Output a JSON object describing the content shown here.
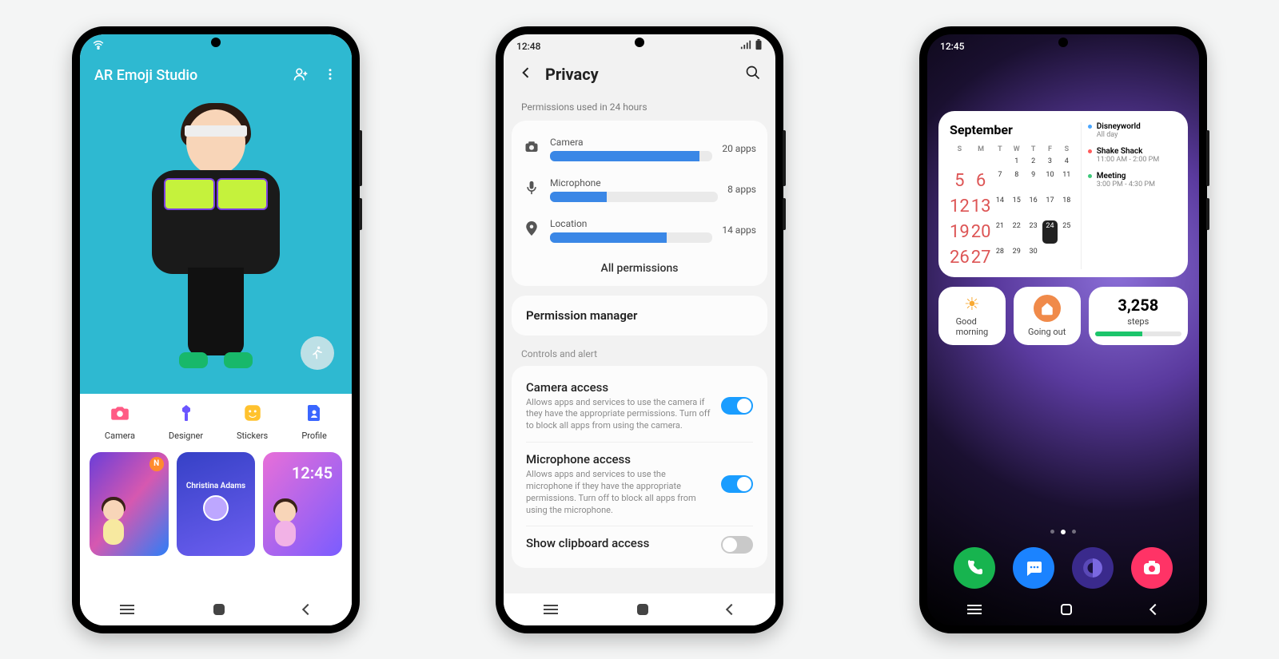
{
  "phone1": {
    "status": {
      "wifi": "wifi-icon"
    },
    "title": "AR Emoji Studio",
    "header_icons": {
      "add_user": "add-user-icon",
      "more": "more-icon"
    },
    "fab": "runner-icon",
    "tools": [
      {
        "label": "Camera",
        "icon": "camera-icon",
        "color": "#ff5b85"
      },
      {
        "label": "Designer",
        "icon": "designer-icon",
        "color": "#6b56ff"
      },
      {
        "label": "Stickers",
        "icon": "stickers-icon",
        "color": "#ffc22e"
      },
      {
        "label": "Profile",
        "icon": "profile-icon",
        "color": "#3a66ff"
      }
    ],
    "cards": {
      "badge": "N",
      "contact_name": "Christina Adams",
      "lock_time": "12:45"
    }
  },
  "phone2": {
    "status": {
      "time": "12:48"
    },
    "title": "Privacy",
    "section_usage_label": "Permissions used in 24 hours",
    "permissions": [
      {
        "icon": "camera-icon",
        "name": "Camera",
        "count": "20 apps",
        "pct": 92
      },
      {
        "icon": "mic-icon",
        "name": "Microphone",
        "count": "8 apps",
        "pct": 34
      },
      {
        "icon": "location-icon",
        "name": "Location",
        "count": "14 apps",
        "pct": 72
      }
    ],
    "all_permissions": "All permissions",
    "permission_manager": "Permission manager",
    "controls_label": "Controls and alert",
    "controls": [
      {
        "title": "Camera access",
        "desc": "Allows apps and services to use the camera if they have the appropriate permissions. Turn off to block all apps from using the camera.",
        "on": true
      },
      {
        "title": "Microphone access",
        "desc": "Allows apps and services to use the microphone if they have the appropriate permissions. Turn off to block all apps from using the microphone.",
        "on": true
      },
      {
        "title": "Show clipboard access",
        "desc": "",
        "on": false
      }
    ]
  },
  "phone3": {
    "status": {
      "time": "12:45"
    },
    "calendar": {
      "month": "September",
      "dow": [
        "S",
        "M",
        "T",
        "W",
        "T",
        "F",
        "S"
      ],
      "days": [
        "",
        "",
        "",
        "1",
        "2",
        "3",
        "4",
        "5",
        "6",
        "7",
        "8",
        "9",
        "10",
        "11",
        "12",
        "13",
        "14",
        "15",
        "16",
        "17",
        "18",
        "19",
        "20",
        "21",
        "22",
        "23",
        "24",
        "25",
        "26",
        "27",
        "28",
        "29",
        "30"
      ],
      "selected": "24",
      "events": [
        {
          "name": "Disneyworld",
          "time": "All day",
          "color": "#4aa6ff"
        },
        {
          "name": "Shake Shack",
          "time": "11:00 AM - 2:00 PM",
          "color": "#ff5b5b"
        },
        {
          "name": "Meeting",
          "time": "3:00 PM - 4:30 PM",
          "color": "#3ec97a"
        }
      ]
    },
    "widgets": {
      "weather": {
        "label_line1": "Good",
        "label_line2": "morning"
      },
      "routine": {
        "label": "Going out"
      },
      "steps": {
        "value": "3,258",
        "label": "steps",
        "progress_pct": 55
      }
    },
    "dock": [
      {
        "name": "phone-icon",
        "color": "#17b44f"
      },
      {
        "name": "messages-icon",
        "color": "#1b83ff"
      },
      {
        "name": "browser-icon",
        "color": "#3a2a8c"
      },
      {
        "name": "camera-icon",
        "color": "#ff3366"
      }
    ]
  },
  "navbar": {
    "recent": "recent",
    "home": "home",
    "back": "back"
  }
}
